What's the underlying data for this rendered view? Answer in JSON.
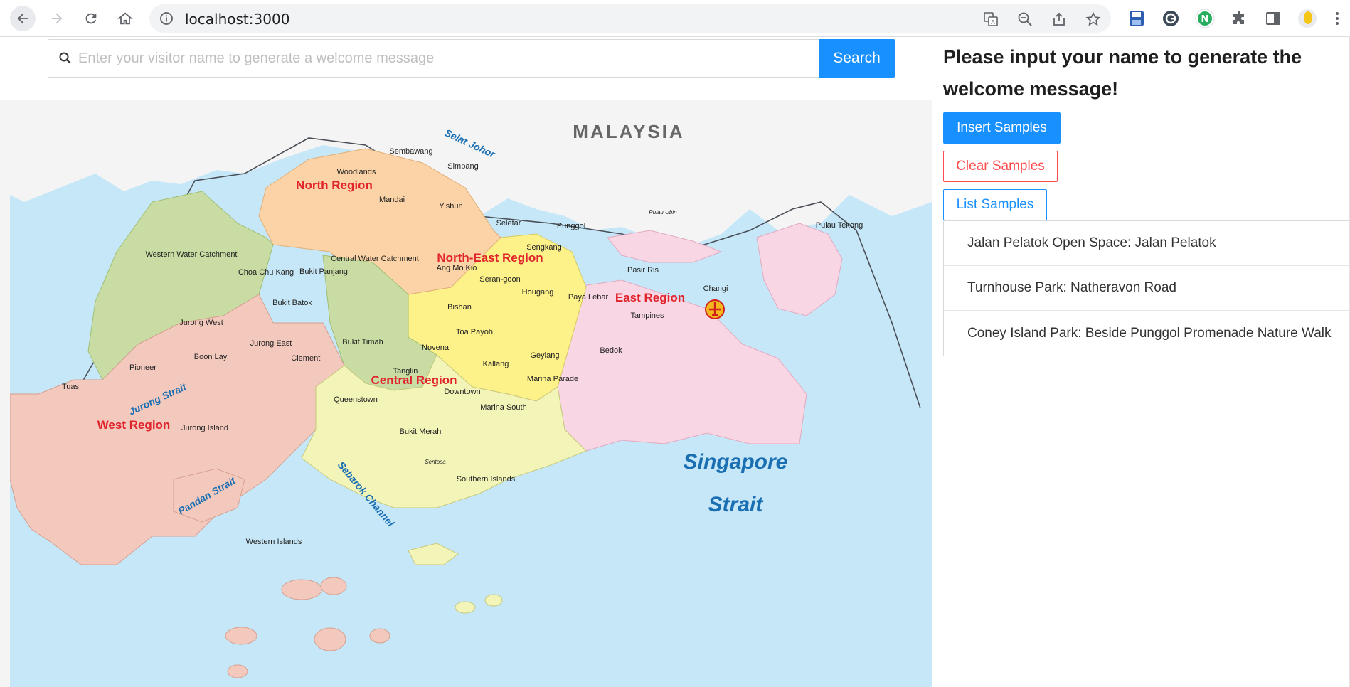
{
  "browser": {
    "url": "localhost:3000",
    "icons": [
      "back-arrow-icon",
      "forward-arrow-icon",
      "reload-icon",
      "home-icon",
      "info-icon",
      "translate-icon",
      "zoom-out-icon",
      "share-icon",
      "star-icon",
      "save-icon",
      "extension-icon",
      "puzzle-icon",
      "side-panel-icon",
      "profile-avatar-icon"
    ]
  },
  "search": {
    "placeholder": "Enter your visitor name to generate a welcome message",
    "button_label": "Search"
  },
  "panel": {
    "title": "Please input your name to generate the welcome message!",
    "insert_label": "Insert Samples",
    "clear_label": "Clear Samples",
    "list_label": "List Samples",
    "results": [
      "Jalan Pelatok Open Space: Jalan Pelatok",
      "Turnhouse Park: Natheravon Road",
      "Coney Island Park: Beside Punggol Promenade Nature Walk"
    ]
  },
  "map": {
    "country_label": "MALAYSIA",
    "strait_label_1": "Singapore",
    "strait_label_2": "Strait",
    "regions": {
      "north": "North Region",
      "north_east": "North-East Region",
      "east": "East Region",
      "central": "Central Region",
      "west": "West Region"
    },
    "places": {
      "sembawang": "Sembawang",
      "woodlands": "Woodlands",
      "simpang": "Simpang",
      "mandai": "Mandai",
      "yishun": "Yishun",
      "seletar": "Seletar",
      "punggol": "Punggol",
      "sengkang": "Sengkang",
      "ang_mo_kio": "Ang Mo Kio",
      "serangoon": "Seran-goon",
      "hougang": "Hougang",
      "pasir_ris": "Pasir Ris",
      "changi": "Changi",
      "tampines": "Tampines",
      "paya_lebar": "Paya Lebar",
      "bedok": "Bedok",
      "bishan": "Bishan",
      "toa_payoh": "Toa Payoh",
      "novena": "Novena",
      "geylang": "Geylang",
      "kallang": "Kallang",
      "tanglin": "Tanglin",
      "bukit_timah": "Bukit Timah",
      "downtown": "Downtown",
      "marina_parade": "Marina Parade",
      "marina_south": "Marina South",
      "queenstown": "Queenstown",
      "bukit_merah": "Bukit Merah",
      "western_water": "Western Water Catchment",
      "central_water": "Central Water Catchment",
      "choa_chu_kang": "Choa Chu Kang",
      "bukit_panjang": "Bukit Panjang",
      "bukit_batok": "Bukit Batok",
      "jurong_west": "Jurong West",
      "jurong_east": "Jurong East",
      "boon_lay": "Boon Lay",
      "clementi": "Clementi",
      "pioneer": "Pioneer",
      "tuas": "Tuas",
      "jurong_island": "Jurong Island",
      "pulau_tekong": "Pulau Tekong",
      "pulau_ubin": "Pulau Ubin",
      "southern_islands": "Southern Islands",
      "western_islands": "Western Islands",
      "sentosa": "Sentosa",
      "selat_johor": "Selat Johor",
      "jurong_strait": "Jurong Strait",
      "pandan_strait": "Pandan Strait",
      "sebarok_channel": "Sebarok Channel"
    }
  },
  "colors": {
    "primary": "#1890ff",
    "danger": "#ff4d4f",
    "water": "#c6e7f7",
    "north": "#fbd3a6",
    "north_east": "#fdf18a",
    "east": "#f9d6e4",
    "central": "#f3f4b8",
    "west": "#f4c9bd",
    "green": "#c8dca3",
    "region_label": "#e0242c"
  }
}
